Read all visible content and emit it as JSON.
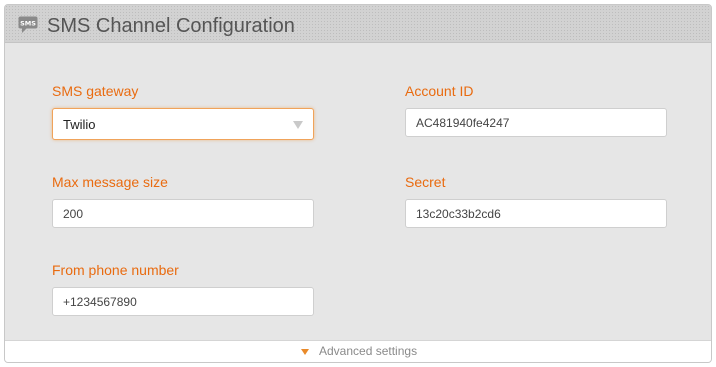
{
  "header": {
    "title": "SMS Channel Configuration",
    "icon": "sms-chat-icon",
    "icon_text": "SMS"
  },
  "fields": {
    "sms_gateway": {
      "label": "SMS gateway",
      "value": "Twilio"
    },
    "account_id": {
      "label": "Account ID",
      "value": "AC481940fe4247"
    },
    "max_message_size": {
      "label": "Max message size",
      "value": "200"
    },
    "secret": {
      "label": "Secret",
      "value": "13c20c33b2cd6"
    },
    "from_phone_number": {
      "label": "From phone number",
      "value": "+1234567890"
    }
  },
  "footer": {
    "advanced_label": "Advanced settings",
    "advanced_icon": "triangle-down-icon"
  },
  "colors": {
    "label": "#e96b10",
    "focus_border": "#f0a35a",
    "accent_arrow": "#e98a2a",
    "header_bg": "#d2d2d2",
    "panel_bg": "#e6e6e6"
  }
}
